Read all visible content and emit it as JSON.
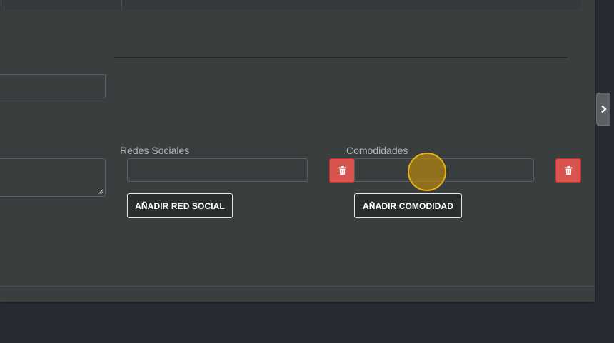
{
  "form": {
    "social": {
      "label": "Redes Sociales",
      "input_value": "",
      "add_button_label": "AÑADIR RED SOCIAL"
    },
    "amenities": {
      "label": "Comodidades",
      "input_value": "",
      "add_button_label": "AÑADIR COMODIDAD"
    },
    "left_input_value": "",
    "left_textarea_value": ""
  },
  "icons": {
    "delete": "trash-icon",
    "side_toggle": "chevron-right-icon"
  },
  "colors": {
    "panel_bg": "#3b3e3f",
    "page_bg": "#252b30",
    "danger": "#d9534f",
    "cursor_highlight": "#f0b914"
  }
}
